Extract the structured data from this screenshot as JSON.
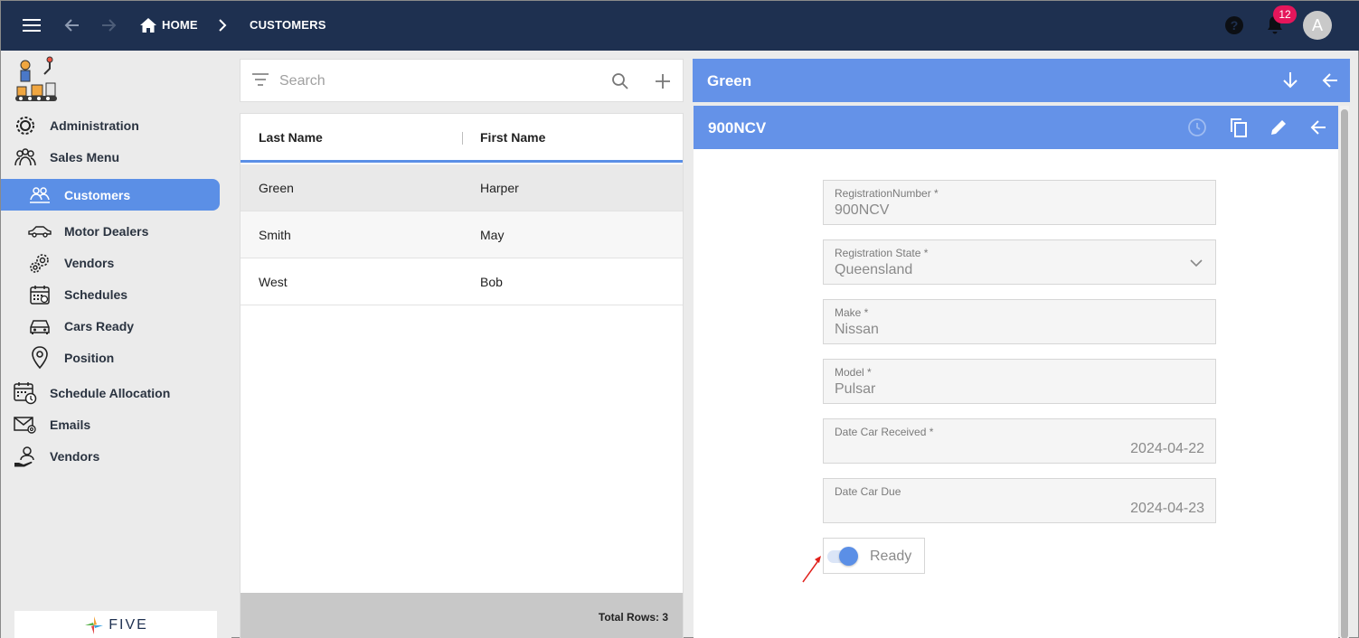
{
  "topbar": {
    "breadcrumbs": [
      "HOME",
      "CUSTOMERS"
    ],
    "notification_count": "12",
    "avatar_initial": "A"
  },
  "sidebar": {
    "items": [
      {
        "label": "Administration",
        "icon": "gear-icon",
        "level": 0
      },
      {
        "label": "Sales Menu",
        "icon": "people-icon",
        "level": 0
      },
      {
        "label": "Customers",
        "icon": "customers-icon",
        "level": 1,
        "active": true
      },
      {
        "label": "Motor Dealers",
        "icon": "car-side-icon",
        "level": 1
      },
      {
        "label": "Vendors",
        "icon": "gears-icon",
        "level": 1
      },
      {
        "label": "Schedules",
        "icon": "calendar-icon",
        "level": 1
      },
      {
        "label": "Cars Ready",
        "icon": "car-front-icon",
        "level": 1
      },
      {
        "label": "Position",
        "icon": "location-pin-icon",
        "level": 1
      },
      {
        "label": "Schedule Allocation",
        "icon": "calendar-clock-icon",
        "level": 0
      },
      {
        "label": "Emails",
        "icon": "email-icon",
        "level": 0
      },
      {
        "label": "Vendors",
        "icon": "vendor-hand-icon",
        "level": 0
      }
    ],
    "brand": "FIVE"
  },
  "list": {
    "search_placeholder": "Search",
    "columns": [
      "Last Name",
      "First Name"
    ],
    "rows": [
      {
        "last": "Green",
        "first": "Harper",
        "selected": true
      },
      {
        "last": "Smith",
        "first": "May"
      },
      {
        "last": "West",
        "first": "Bob"
      }
    ],
    "total_rows": "Total Rows: 3"
  },
  "detail": {
    "customer_title": "Green",
    "vehicle_title": "900NCV",
    "fields": [
      {
        "label": "RegistrationNumber *",
        "value": "900NCV"
      },
      {
        "label": "Registration State *",
        "value": "Queensland",
        "type": "select"
      },
      {
        "label": "Make *",
        "value": "Nissan"
      },
      {
        "label": "Model *",
        "value": "Pulsar"
      },
      {
        "label": "Date Car Received *",
        "value": "2024-04-22",
        "align": "right"
      },
      {
        "label": "Date Car Due",
        "value": "2024-04-23",
        "align": "right"
      }
    ],
    "toggle": {
      "label": "Ready",
      "on": true
    }
  },
  "colors": {
    "topbar": "#1e3050",
    "accent": "#6492e8",
    "active_nav": "#5b8fe6",
    "badge": "#e5165b",
    "annotation_arrow": "#e0201b"
  }
}
